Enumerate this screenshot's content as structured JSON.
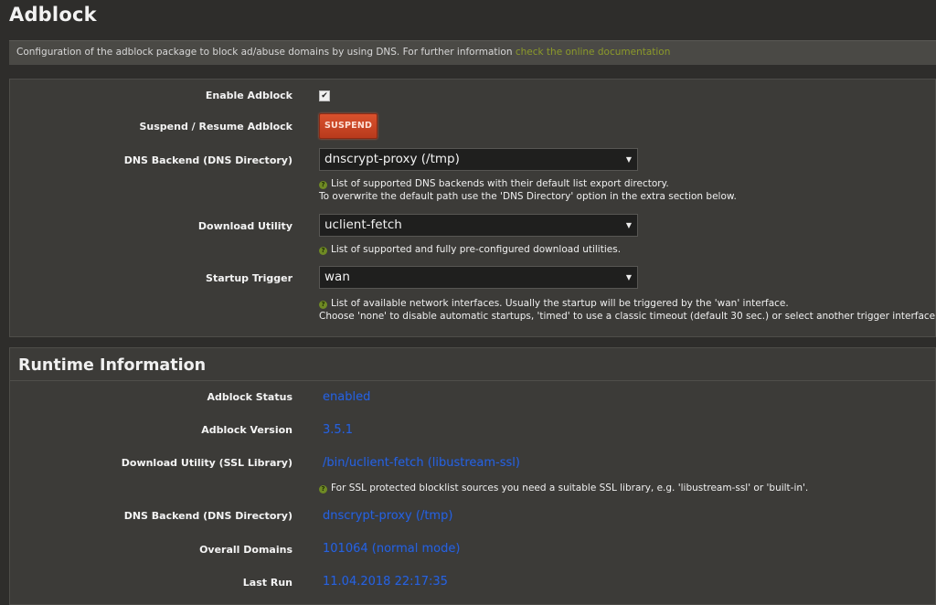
{
  "page": {
    "title": "Adblock",
    "description": "Configuration of the adblock package to block ad/abuse domains by using DNS. For further information",
    "description_link": "check the online documentation"
  },
  "config": {
    "enable": {
      "label": "Enable Adblock",
      "checked": true,
      "check_glyph": "✔"
    },
    "suspend": {
      "label": "Suspend / Resume Adblock",
      "button": "SUSPEND"
    },
    "dns_backend": {
      "label": "DNS Backend (DNS Directory)",
      "value": "dnscrypt-proxy (/tmp)",
      "help_line1": "List of supported DNS backends with their default list export directory.",
      "help_line2": "To overwrite the default path use the 'DNS Directory' option in the extra section below."
    },
    "download_utility": {
      "label": "Download Utility",
      "value": "uclient-fetch",
      "help_line1": "List of supported and fully pre-configured download utilities."
    },
    "startup_trigger": {
      "label": "Startup Trigger",
      "value": "wan",
      "help_line1": "List of available network interfaces. Usually the startup will be triggered by the 'wan' interface.",
      "help_line2": "Choose 'none' to disable automatic startups, 'timed' to use a classic timeout (default 30 sec.) or select another trigger interface."
    }
  },
  "runtime": {
    "title": "Runtime Information",
    "status": {
      "label": "Adblock Status",
      "value": "enabled"
    },
    "version": {
      "label": "Adblock Version",
      "value": "3.5.1"
    },
    "ssl": {
      "label": "Download Utility (SSL Library)",
      "value": "/bin/uclient-fetch (libustream-ssl)",
      "help": "For SSL protected blocklist sources you need a suitable SSL library, e.g. 'libustream-ssl' or 'built-in'."
    },
    "dns_backend": {
      "label": "DNS Backend (DNS Directory)",
      "value": "dnscrypt-proxy (/tmp)"
    },
    "domains": {
      "label": "Overall Domains",
      "value": "101064 (normal mode)"
    },
    "last_run": {
      "label": "Last Run",
      "value": "11.04.2018 22:17:35"
    }
  },
  "icons": {
    "help": "help-icon",
    "caret": "chevron-down-icon",
    "help_glyph": "?",
    "caret_glyph": "▼"
  },
  "colors": {
    "background": "#2e2d2b",
    "panel": "#3c3b38",
    "value_blue": "#2a62d8",
    "danger_button": "#c9441f",
    "link_green": "#8c9a2a"
  }
}
